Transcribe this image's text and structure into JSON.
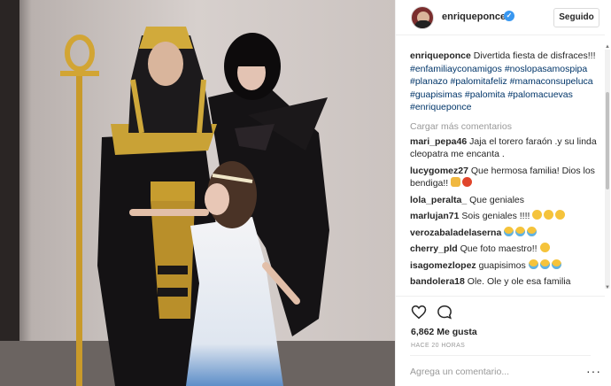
{
  "post": {
    "username": "enriqueponce",
    "follow_label": "Seguido",
    "verified_mark": "✓"
  },
  "caption": {
    "username": "enriqueponce",
    "text": "Divertida fiesta de disfraces!!!",
    "hashtags": [
      "#enfamiliayconamigos",
      "#noslopasamospipa",
      "#planazo",
      "#palomitafeliz",
      "#mamaconsupeluca",
      "#guapisimas",
      "#palomita",
      "#palomacuevas",
      "#enriqueponce"
    ]
  },
  "load_more": "Cargar más comentarios",
  "comments": [
    {
      "user": "mari_pepa46",
      "text": "Jaja el torero faraón .y su linda cleopatra me encanta .",
      "emojis": []
    },
    {
      "user": "lucygomez27",
      "text": "Que hermosa familia! Dios los bendiga!!",
      "emojis": [
        "pray",
        "red"
      ]
    },
    {
      "user": "lola_peralta_",
      "text": "Que geniales",
      "emojis": []
    },
    {
      "user": "marlujan71",
      "text": "Sois geniales !!!!",
      "emojis": [
        "yellow",
        "yellow",
        "yellow"
      ]
    },
    {
      "user": "verozabaladelaserna",
      "text": "",
      "emojis": [
        "cry",
        "cry",
        "cry"
      ]
    },
    {
      "user": "cherry_pld",
      "text": "Que foto maestro!!",
      "emojis": [
        "yellow"
      ]
    },
    {
      "user": "isagomezlopez",
      "text": "guapisimos",
      "emojis": [
        "cry",
        "cry",
        "cry"
      ]
    },
    {
      "user": "bandolera18",
      "text": "Ole. Ole y ole esa familia",
      "emojis": []
    }
  ],
  "likes": "6,862 Me gusta",
  "timestamp": "HACE 20 HORAS",
  "add_comment_placeholder": "Agrega un comentario...",
  "more_options": "···",
  "icons": {
    "like": "heart-icon",
    "comment": "comment-icon",
    "verified": "verified-badge-icon"
  },
  "colors": {
    "link": "#003569",
    "verified": "#3897f0",
    "muted": "#999999"
  }
}
